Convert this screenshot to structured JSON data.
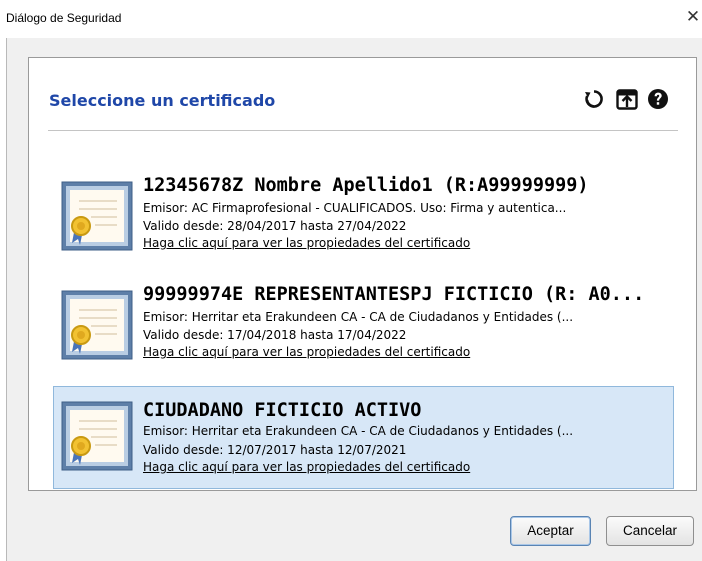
{
  "window": {
    "title": "Diálogo de Seguridad",
    "close_glyph": "✕"
  },
  "panel": {
    "heading": "Seleccione un certificado"
  },
  "toolbar": {
    "icons": [
      "refresh-icon",
      "import-certificate-icon",
      "help-icon"
    ]
  },
  "certificates": [
    {
      "name": "12345678Z Nombre Apellido1 (R:A99999999)",
      "issuer": "Emisor: AC Firmaprofesional - CUALIFICADOS. Uso: Firma y autentica...",
      "validity": "Valido desde: 28/04/2017 hasta 27/04/2022",
      "link": "Haga clic aquí para ver las propiedades del certificado",
      "selected": false
    },
    {
      "name": "99999974E REPRESENTANTESPJ FICTICIO (R: A0...",
      "issuer": "Emisor: Herritar eta Erakundeen CA - CA de Ciudadanos y Entidades (...",
      "validity": "Valido desde: 17/04/2018 hasta 17/04/2022",
      "link": "Haga clic aquí para ver las propiedades del certificado",
      "selected": false
    },
    {
      "name": "CIUDADANO FICTICIO ACTIVO",
      "issuer": "Emisor: Herritar eta Erakundeen CA - CA de Ciudadanos y Entidades (...",
      "validity": "Valido desde: 12/07/2017 hasta 12/07/2021",
      "link": "Haga clic aquí para ver las propiedades del certificado",
      "selected": true
    }
  ],
  "buttons": {
    "accept": "Aceptar",
    "cancel": "Cancelar"
  },
  "colors": {
    "heading": "#1f47a8",
    "selection": "#d7e7f7",
    "selection_border": "#90b8dc"
  }
}
